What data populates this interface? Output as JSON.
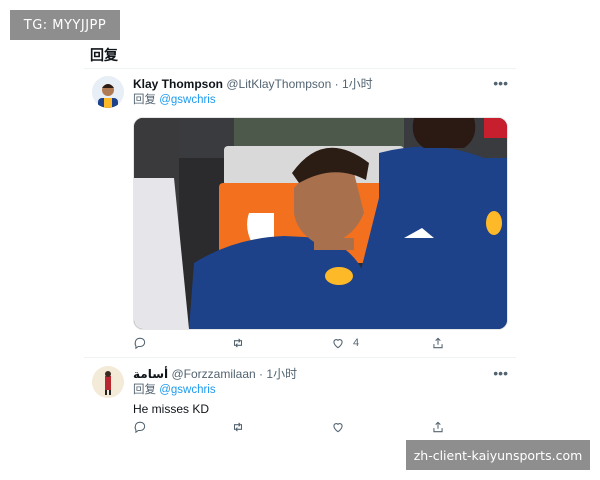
{
  "watermarks": {
    "top_left": "TG: MYYJJPP",
    "bottom_right": "zh-client-kaiyunsports.com"
  },
  "page": {
    "title": "回复"
  },
  "tweets": [
    {
      "name": "Klay Thompson",
      "handle": "@LitKlayThompson",
      "time": "1小时",
      "reply_prefix": "回复",
      "reply_to": "@gswchris",
      "text": "",
      "stats": {
        "reply": "",
        "retweet": "",
        "like": "4",
        "share": ""
      }
    },
    {
      "name": "أسامة",
      "handle": "@Forzzamilaan",
      "time": "1小时",
      "reply_prefix": "回复",
      "reply_to": "@gswchris",
      "text": "He misses KD",
      "stats": {
        "reply": "",
        "retweet": "",
        "like": "",
        "share": ""
      }
    }
  ],
  "colors": {
    "link": "#1d9bf0",
    "muted": "#536471",
    "jersey": "#1d428a",
    "gatorade": "#f2701e"
  },
  "icons": [
    "more-icon",
    "reply-icon",
    "retweet-icon",
    "like-icon",
    "share-icon"
  ]
}
